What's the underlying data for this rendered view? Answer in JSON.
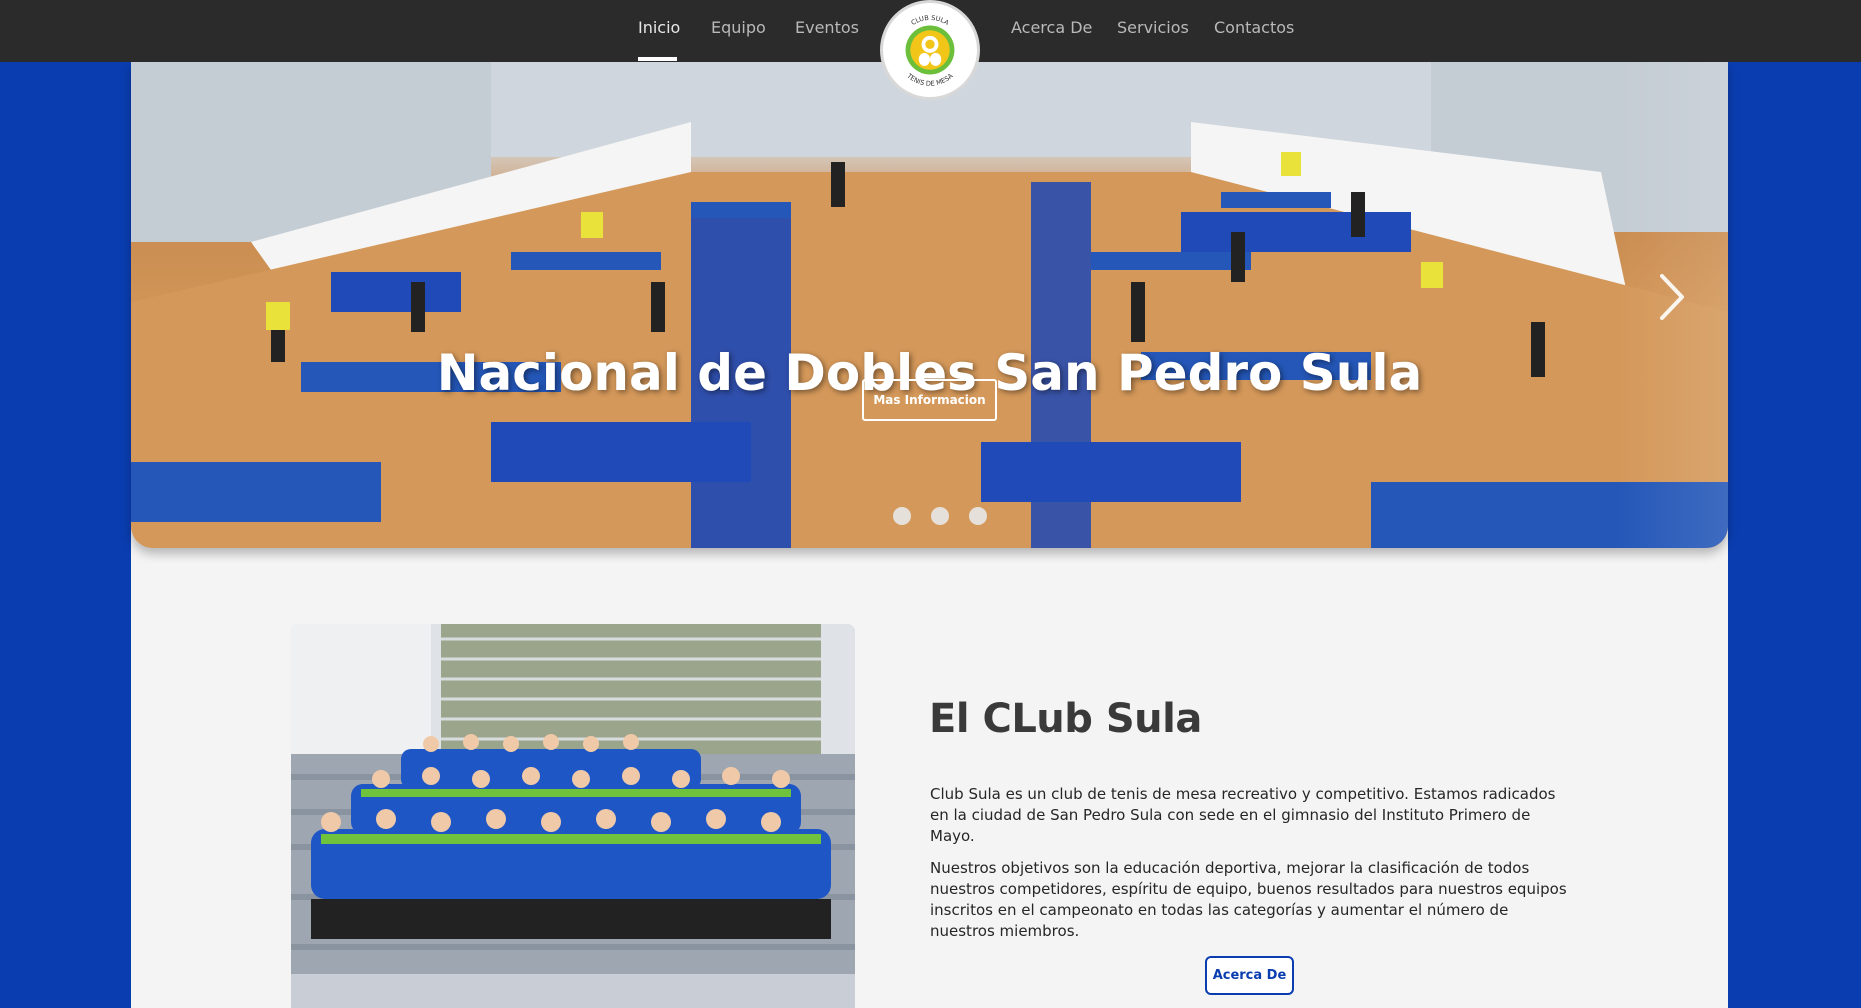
{
  "nav": {
    "items": [
      {
        "label": "Inicio",
        "active": true
      },
      {
        "label": "Equipo",
        "active": false
      },
      {
        "label": "Eventos",
        "active": false
      },
      {
        "label": "Acerca De",
        "active": false
      },
      {
        "label": "Servicios",
        "active": false
      },
      {
        "label": "Contactos",
        "active": false
      }
    ],
    "logo": {
      "top_text": "CLUB SULA",
      "bottom_text": "TENIS DE MESA"
    }
  },
  "hero": {
    "title": "Nacional de Dobles San Pedro Sula",
    "button_label": "Mas Informacion",
    "slide_count": 3,
    "next_icon": "chevron-right-icon"
  },
  "about": {
    "title": "El CLub Sula",
    "paragraphs": [
      "Club Sula es un club de tenis de mesa recreativo y competitivo. Estamos radicados en la ciudad de San Pedro Sula con sede en el gimnasio del Instituto Primero de Mayo.",
      "Nuestros objetivos son la educación deportiva, mejorar la clasificación de todos nuestros competidores, espíritu de equipo, buenos resultados para nuestros equipos inscritos en el campeonato en todas las categorías y aumentar el número de nuestros miembros."
    ],
    "button_label": "Acerca De"
  },
  "colors": {
    "background_blue": "#0a3db0",
    "navbar": "#2b2b2b",
    "logo_green": "#6bbf3a",
    "logo_yellow": "#f2c618"
  }
}
